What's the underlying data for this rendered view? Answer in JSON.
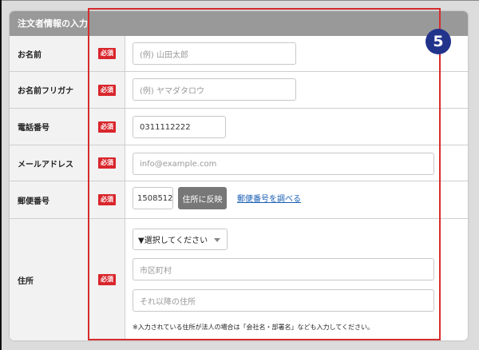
{
  "header": {
    "title": "注文者情報の入力"
  },
  "required_label": "必須",
  "rows": {
    "name": {
      "label": "お名前",
      "placeholder": "(例) 山田太郎"
    },
    "kana": {
      "label": "お名前フリガナ",
      "placeholder": "(例) ヤマダタロウ"
    },
    "phone": {
      "label": "電話番号",
      "value": "0311112222"
    },
    "email": {
      "label": "メールアドレス",
      "placeholder": "info@example.com"
    },
    "zip": {
      "label": "郵便番号",
      "value": "1508512",
      "reflect_button": "住所に反映",
      "lookup_link": "郵便番号を調べる"
    },
    "address": {
      "label": "住所",
      "select_value": "▼選択してください",
      "city_placeholder": "市区町村",
      "rest_placeholder": "それ以降の住所",
      "note": "※入力されている住所が法人の場合は「会社名・部署名」なども入力してください。"
    }
  },
  "step_badge": "5",
  "colors": {
    "highlight": "#d62c2c",
    "badge": "#22338c",
    "required": "#d9262c",
    "link": "#1a5fb4"
  }
}
